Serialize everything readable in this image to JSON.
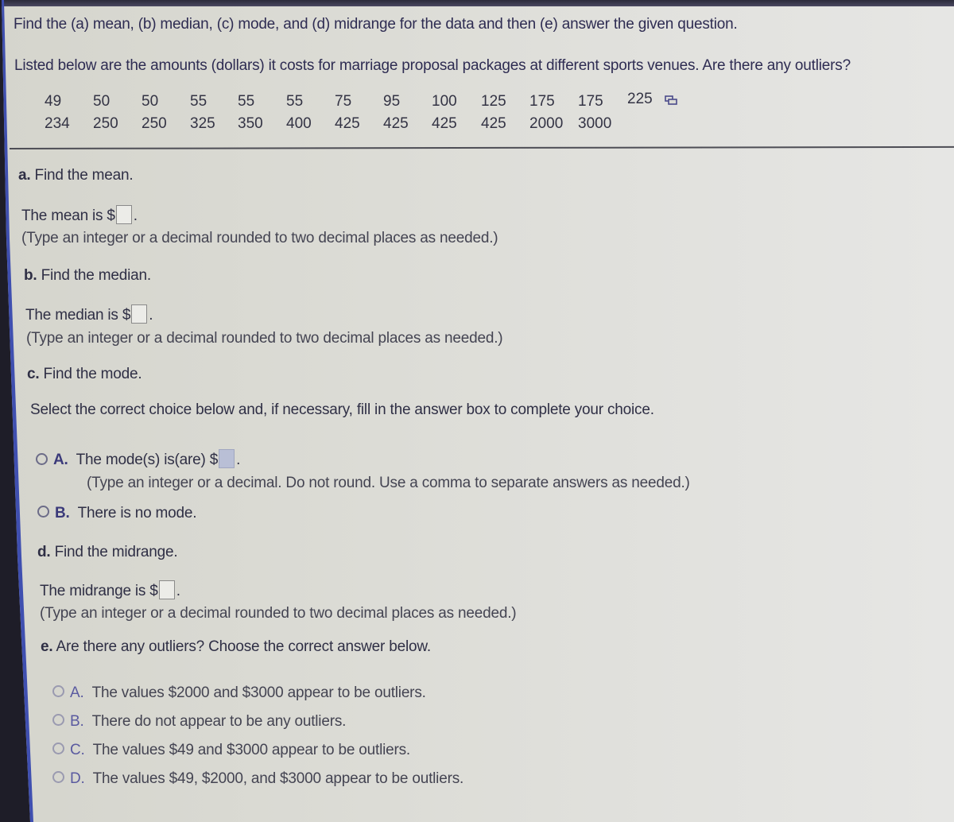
{
  "instructions": "Find the (a) mean, (b) median, (c) mode, and (d) midrange for the data and then (e) answer the given question.",
  "problem_statement": "Listed below are the amounts (dollars) it costs for marriage proposal packages at different sports venues. Are there any outliers?",
  "data_values": {
    "row1": [
      "49",
      "50",
      "50",
      "55",
      "55",
      "55",
      "75",
      "95",
      "100",
      "125",
      "175",
      "175",
      "225"
    ],
    "row2": [
      "234",
      "250",
      "250",
      "325",
      "350",
      "400",
      "425",
      "425",
      "425",
      "425",
      "2000",
      "3000"
    ],
    "popout_icon": "popout-window-icon"
  },
  "part_a": {
    "label": "a.",
    "heading": "Find the mean.",
    "prompt": "The mean is $",
    "answer_value": "",
    "hint": "(Type an integer or a decimal rounded to two decimal places as needed.)"
  },
  "part_b": {
    "label": "b.",
    "heading": "Find the median.",
    "prompt": "The median is $",
    "answer_value": "",
    "hint": "(Type an integer or a decimal rounded to two decimal places as needed.)"
  },
  "part_c": {
    "label": "c.",
    "heading": "Find the mode.",
    "instruction": "Select the correct choice below and, if necessary, fill in the answer box to complete your choice.",
    "choices": [
      {
        "letter": "A.",
        "text": "The mode(s) is(are) $",
        "answer_value": "",
        "hint": "(Type an integer or a decimal. Do not round. Use a comma to separate answers as needed.)",
        "selected": false
      },
      {
        "letter": "B.",
        "text": "There is no mode.",
        "selected": false
      }
    ]
  },
  "part_d": {
    "label": "d.",
    "heading": "Find the midrange.",
    "prompt": "The midrange is $",
    "answer_value": "",
    "hint": "(Type an integer or a decimal rounded to two decimal places as needed.)"
  },
  "part_e": {
    "label": "e.",
    "heading": "Are there any outliers? Choose the correct answer below.",
    "choices": [
      {
        "letter": "A.",
        "text": "The values $2000 and $3000 appear to be outliers.",
        "selected": false
      },
      {
        "letter": "B.",
        "text": "There do not appear to be any outliers.",
        "selected": false
      },
      {
        "letter": "C.",
        "text": "The values $49 and $3000 appear to be outliers.",
        "selected": false
      },
      {
        "letter": "D.",
        "text": "The values $49, $2000, and $3000 appear to be outliers.",
        "selected": false
      }
    ]
  },
  "colors": {
    "page_background": "#dcdcd6",
    "text": "#2f2f45",
    "choice_letter": "#3b3a7a",
    "shaded_answer_box": "#b9bfd6"
  }
}
